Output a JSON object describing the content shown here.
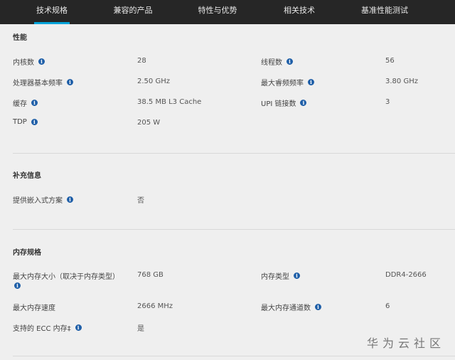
{
  "nav": {
    "tabs": [
      {
        "label": "技术规格",
        "active": true
      },
      {
        "label": "兼容的产品",
        "active": false
      },
      {
        "label": "特性与优势",
        "active": false
      },
      {
        "label": "相关技术",
        "active": false
      },
      {
        "label": "基准性能测试",
        "active": false
      }
    ]
  },
  "performance": {
    "title": "性能",
    "cores_label": "内核数",
    "cores_value": "28",
    "threads_label": "线程数",
    "threads_value": "56",
    "base_freq_label": "处理器基本频率",
    "base_freq_value": "2.50 GHz",
    "turbo_freq_label": "最大睿频频率",
    "turbo_freq_value": "3.80 GHz",
    "cache_label": "缓存",
    "cache_value": "38.5 MB L3 Cache",
    "upi_label": "UPI 链接数",
    "upi_value": "3",
    "tdp_label": "TDP",
    "tdp_value": "205 W"
  },
  "supplemental": {
    "title": "补充信息",
    "embedded_label": "提供嵌入式方案",
    "embedded_value": "否"
  },
  "memory": {
    "title": "内存规格",
    "max_size_label": "最大内存大小（取决于内存类型）",
    "max_size_value": "768 GB",
    "type_label": "内存类型",
    "type_value": "DDR4-2666",
    "speed_label": "最大内存速度",
    "speed_value": "2666 MHz",
    "channels_label": "最大内存通道数",
    "channels_value": "6",
    "ecc_label": "支持的 ECC 内存‡",
    "ecc_value": "是"
  },
  "watermark": "华为云社区",
  "colors": {
    "nav_bg": "#262626",
    "accent": "#00a3d9",
    "info_icon": "#1f5fa8",
    "page_bg": "#efefef"
  }
}
